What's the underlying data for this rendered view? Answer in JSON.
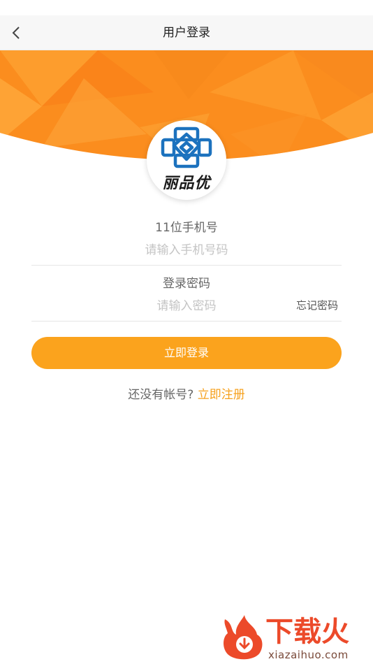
{
  "nav": {
    "title": "用户登录"
  },
  "brand": {
    "logo_text": "丽品优"
  },
  "phone": {
    "label": "11位手机号",
    "placeholder": "请输入手机号码",
    "value": ""
  },
  "password": {
    "label": "登录密码",
    "placeholder": "请输入密码",
    "value": ""
  },
  "forgot_label": "忘记密码",
  "login_label": "立即登录",
  "register": {
    "prompt": "还没有帐号?",
    "link": "立即注册"
  },
  "watermark": {
    "name": "下载火",
    "url": "xiazaihuo.com"
  },
  "colors": {
    "accent": "#f6a11e",
    "banner": "#fb8d1e",
    "logo_blue": "#1c72be"
  },
  "icons": [
    "back-icon",
    "logo-knot-icon",
    "flame-download-icon"
  ]
}
